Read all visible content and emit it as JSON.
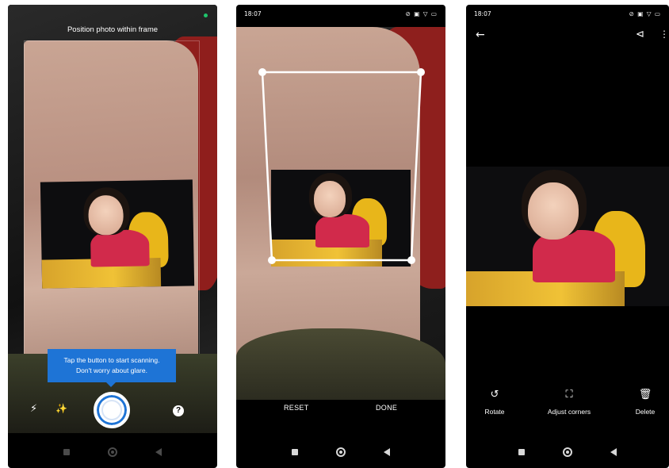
{
  "screens": [
    {
      "id": "camera",
      "status_indicator_color": "#1ec46b",
      "instruction": "Position photo within frame",
      "tip": [
        "Tap the button to start scanning.",
        "Don't worry about glare."
      ],
      "icons": [
        "flash-icon",
        "magic-wand-icon",
        "shutter-button",
        "help-icon"
      ],
      "help_label": "?"
    },
    {
      "id": "crop",
      "status": {
        "time": "18:07",
        "icons": "⊘ ▣ ▽ ▭"
      },
      "reset_label": "RESET",
      "done_label": "DONE"
    },
    {
      "id": "result",
      "status": {
        "time": "18:07",
        "icons": "⊘ ▣ ▽ ▭"
      },
      "actions": [
        {
          "label": "Rotate",
          "icon": "rotate-icon"
        },
        {
          "label": "Adjust corners",
          "icon": "crop-corners-icon"
        },
        {
          "label": "Delete",
          "icon": "trash-icon"
        }
      ]
    }
  ],
  "colors": {
    "accent": "#1e74d6",
    "background": "#000000"
  }
}
